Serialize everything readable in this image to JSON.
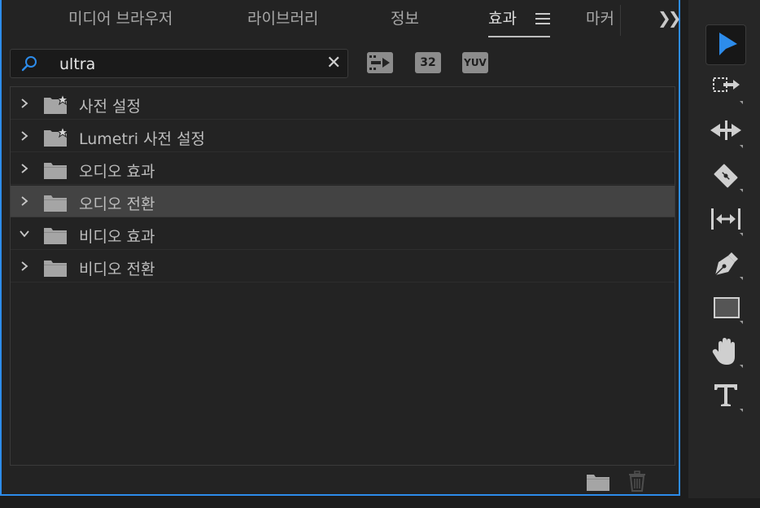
{
  "tabs": [
    {
      "label": "미디어 브라우저"
    },
    {
      "label": "라이브러리"
    },
    {
      "label": "정보"
    },
    {
      "label": "효과",
      "active": true
    },
    {
      "label": "마커"
    }
  ],
  "search": {
    "value": "ultra",
    "placeholder": ""
  },
  "filter_buttons": [
    "32",
    "YUV"
  ],
  "tree_items": [
    {
      "label": "사전 설정",
      "expanded": false,
      "icon": "preset-folder-icon"
    },
    {
      "label": "Lumetri 사전 설정",
      "expanded": false,
      "icon": "preset-folder-icon"
    },
    {
      "label": "오디오 효과",
      "expanded": false,
      "icon": "folder-icon"
    },
    {
      "label": "오디오 전환",
      "expanded": false,
      "selected": true,
      "icon": "folder-icon"
    },
    {
      "label": "비디오 효과",
      "expanded": true,
      "icon": "folder-icon"
    },
    {
      "label": "비디오 전환",
      "expanded": false,
      "icon": "folder-icon"
    }
  ],
  "tools": [
    "selection-tool-icon",
    "track-select-tool-icon",
    "ripple-edit-tool-icon",
    "razor-tool-icon",
    "slip-tool-icon",
    "pen-tool-icon",
    "rectangle-tool-icon",
    "hand-tool-icon",
    "type-tool-icon"
  ],
  "colors": {
    "accent": "#2d8ceb",
    "panel_bg": "#232323",
    "selected_row": "#434343"
  }
}
